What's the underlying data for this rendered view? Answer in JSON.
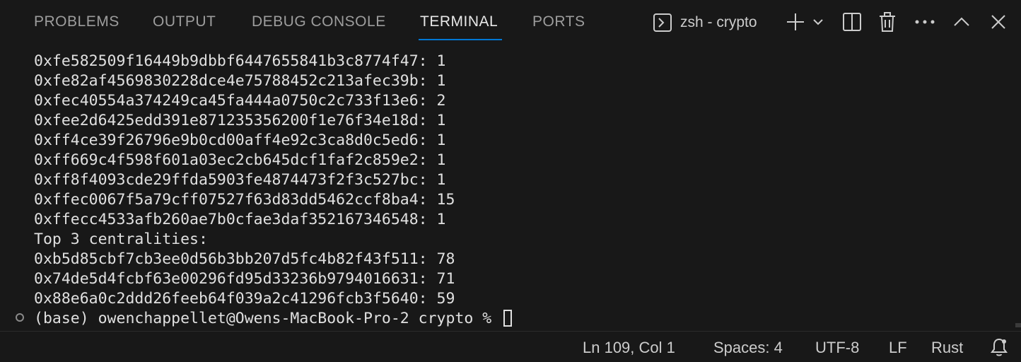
{
  "panel": {
    "tabs": [
      {
        "label": "PROBLEMS"
      },
      {
        "label": "OUTPUT"
      },
      {
        "label": "DEBUG CONSOLE"
      },
      {
        "label": "TERMINAL"
      },
      {
        "label": "PORTS"
      }
    ],
    "active_tab": "TERMINAL",
    "terminal_name": "zsh - crypto",
    "actions": [
      "terminal-icon",
      "plus-icon",
      "chevron-down-icon",
      "split-icon",
      "trash-icon",
      "ellipsis-icon",
      "chevron-up-icon",
      "close-icon"
    ]
  },
  "terminal": {
    "lines": [
      "0xfe582509f16449b9dbbf6447655841b3c8774f47: 1",
      "0xfe82af4569830228dce4e75788452c213afec39b: 1",
      "0xfec40554a374249ca45fa444a0750c2c733f13e6: 2",
      "0xfee2d6425edd391e871235356200f1e76f34e18d: 1",
      "0xff4ce39f26796e9b0cd00aff4e92c3ca8d0c5ed6: 1",
      "0xff669c4f598f601a03ec2cb645dcf1faf2c859e2: 1",
      "0xff8f4093cde29ffda5903fe4874473f2f3c527bc: 1",
      "0xffec0067f5a79cff07527f63d83dd5462ccf8ba4: 15",
      "0xffecc4533afb260ae7b0cfae3daf352167346548: 1",
      "Top 3 centralities:",
      "0xb5d85cbf7cb3ee0d56b3bb207d5fc4b82f43f511: 78",
      "0x74de5d4fcbf63e00296fd95d33236b9794016631: 71",
      "0x88e6a0c2ddd26feeb64f039a2c41296fcb3f5640: 59"
    ],
    "prompt": "(base) owenchappellet@Owens-MacBook-Pro-2 crypto % "
  },
  "status_bar": {
    "position": "Ln 109, Col 1",
    "spaces": "Spaces: 4",
    "encoding": "UTF-8",
    "eol": "LF",
    "language": "Rust"
  },
  "colors": {
    "background": "#181818",
    "accent": "#0078d4",
    "text": "#cccccc"
  }
}
